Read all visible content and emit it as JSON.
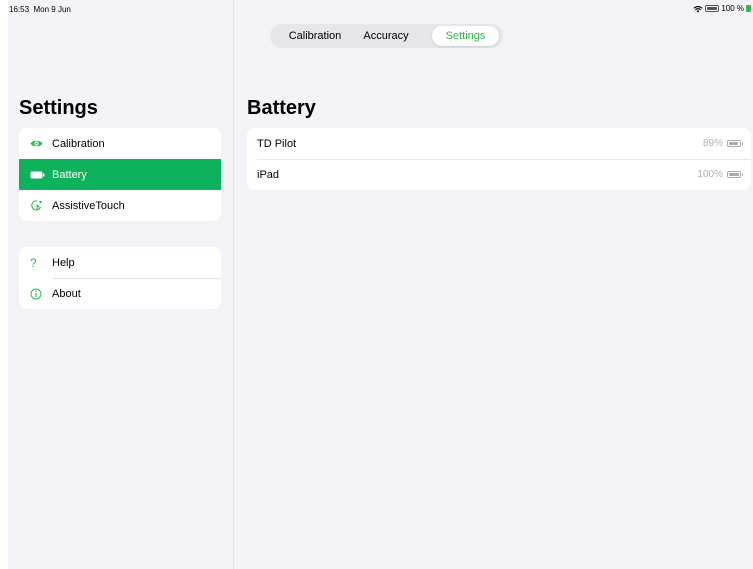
{
  "status_bar": {
    "time": "16:53",
    "date": "Mon 9 Jun",
    "battery_text": "100 %"
  },
  "segmented": {
    "items": [
      "Calibration",
      "Accuracy",
      "Settings"
    ],
    "selected": "Settings"
  },
  "sidebar": {
    "title": "Settings",
    "groups": [
      {
        "items": [
          {
            "label": "Calibration",
            "icon": "eye-icon",
            "selected": false
          },
          {
            "label": "Battery",
            "icon": "battery-icon",
            "selected": true
          },
          {
            "label": "AssistiveTouch",
            "icon": "assistive-touch-icon",
            "selected": false
          }
        ]
      },
      {
        "items": [
          {
            "label": "Help",
            "icon": "question-icon",
            "selected": false
          },
          {
            "label": "About",
            "icon": "info-icon",
            "selected": false
          }
        ]
      }
    ]
  },
  "main": {
    "title": "Battery",
    "devices": [
      {
        "name": "TD Pilot",
        "percent": "89%"
      },
      {
        "name": "iPad",
        "percent": "100%"
      }
    ]
  },
  "colors": {
    "accent": "#2db84d",
    "selected_row": "#0fb25c",
    "background": "#f2f2f7"
  }
}
